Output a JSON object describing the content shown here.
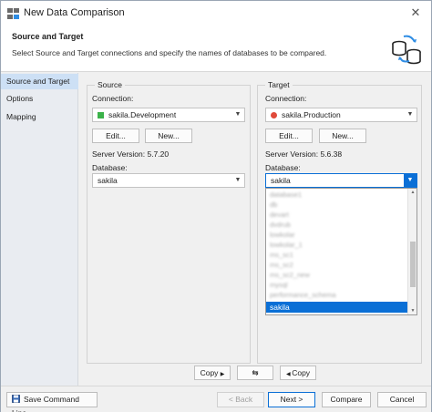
{
  "window": {
    "title": "New Data Comparison",
    "close_glyph": "✕"
  },
  "header": {
    "title": "Source and Target",
    "description": "Select Source and Target connections and specify the names of databases to be compared."
  },
  "sidebar": {
    "items": [
      {
        "label": "Source and Target"
      },
      {
        "label": "Options"
      },
      {
        "label": "Mapping"
      }
    ]
  },
  "source": {
    "group_label": "Source",
    "connection_label": "Connection:",
    "connection_value": "sakila.Development",
    "connection_status_color": "#3cb34a",
    "edit_label": "Edit...",
    "new_label": "New...",
    "server_version": "Server Version: 5.7.20",
    "database_label": "Database:",
    "database_value": "sakila"
  },
  "target": {
    "group_label": "Target",
    "connection_label": "Connection:",
    "connection_value": "sakila.Production",
    "connection_status_color": "#e04a3a",
    "edit_label": "Edit...",
    "new_label": "New...",
    "server_version": "Server Version: 5.6.38",
    "database_label": "Database:",
    "database_value": "sakila",
    "dropdown_items": [
      "database1",
      "db",
      "devart",
      "dvdrub",
      "lowkolar",
      "lowkolar_1",
      "ms_sc1",
      "ms_sc2",
      "ms_sc2_new",
      "mysql",
      "performance_schema",
      "sakila"
    ],
    "dropdown_selected": "sakila"
  },
  "actions": {
    "copy_right_label": "Copy",
    "copy_left_label": "Copy",
    "swap_glyph": "⇆"
  },
  "footer": {
    "save_command_line_label": "Save Command Line...",
    "back_label": "< Back",
    "next_label": "Next >",
    "compare_label": "Compare",
    "cancel_label": "Cancel"
  },
  "colors": {
    "accent": "#0a6fd6",
    "sidebar_active": "#cde0f5"
  }
}
